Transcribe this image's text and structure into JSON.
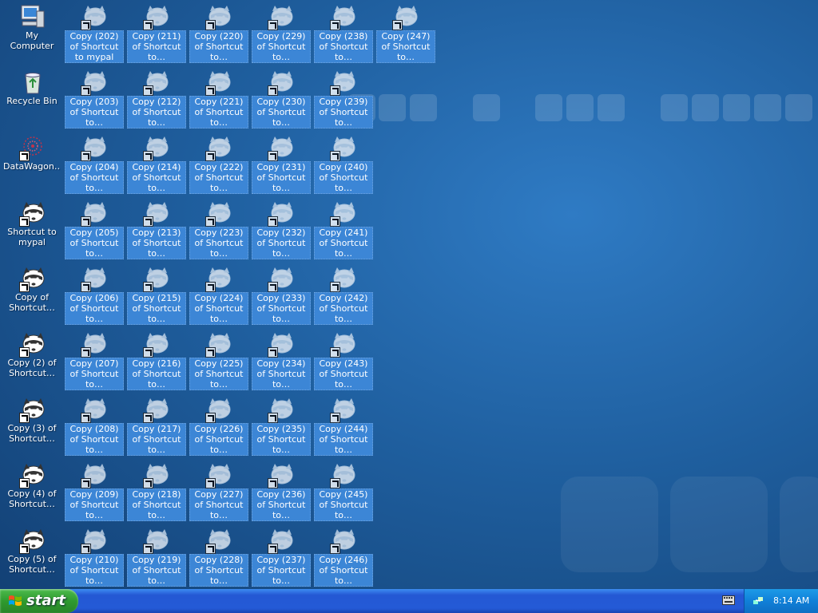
{
  "desktop": {
    "system_icons": [
      {
        "name": "my-computer-icon",
        "label": "My Computer",
        "kind": "computer",
        "selected": false
      },
      {
        "name": "recycle-bin-icon",
        "label": "Recycle Bin",
        "kind": "bin",
        "selected": false
      },
      {
        "name": "datawagon-icon",
        "label": "DataWagon…",
        "kind": "data",
        "selected": false
      },
      {
        "name": "shortcut-to-mypal-icon",
        "label": "Shortcut to mypal",
        "kind": "raccoon",
        "selected": false
      },
      {
        "name": "copy-of-shortcut-icon",
        "label": "Copy of Shortcut…",
        "kind": "raccoon",
        "selected": false
      },
      {
        "name": "copy-2-of-shortcut-icon",
        "label": "Copy (2) of Shortcut…",
        "kind": "raccoon",
        "selected": false
      },
      {
        "name": "copy-3-of-shortcut-icon",
        "label": "Copy (3) of Shortcut…",
        "kind": "raccoon",
        "selected": false
      },
      {
        "name": "copy-4-of-shortcut-icon",
        "label": "Copy (4) of Shortcut…",
        "kind": "raccoon",
        "selected": false
      },
      {
        "name": "copy-5-of-shortcut-icon",
        "label": "Copy (5) of Shortcut…",
        "kind": "raccoon",
        "selected": false
      }
    ],
    "columns": [
      [
        "Copy (202) of Shortcut to mypal",
        "Copy (203) of Shortcut to…",
        "Copy (204) of Shortcut to…",
        "Copy (205) of Shortcut to…",
        "Copy (206) of Shortcut to…",
        "Copy (207) of Shortcut to…",
        "Copy (208) of Shortcut to…",
        "Copy (209) of Shortcut to…",
        "Copy (210) of Shortcut to…"
      ],
      [
        "Copy (211) of Shortcut to…",
        "Copy (212) of Shortcut to…",
        "Copy (214) of Shortcut to…",
        "Copy (213) of Shortcut to…",
        "Copy (215) of Shortcut to…",
        "Copy (216) of Shortcut to…",
        "Copy (217) of Shortcut to…",
        "Copy (218) of Shortcut to…",
        "Copy (219) of Shortcut to…"
      ],
      [
        "Copy (220) of Shortcut to…",
        "Copy (221) of Shortcut to…",
        "Copy (222) of Shortcut to…",
        "Copy (223) of Shortcut to…",
        "Copy (224) of Shortcut to…",
        "Copy (225) of Shortcut to…",
        "Copy (226) of Shortcut to…",
        "Copy (227) of Shortcut to…",
        "Copy (228) of Shortcut to…"
      ],
      [
        "Copy (229) of Shortcut to…",
        "Copy (230) of Shortcut to…",
        "Copy (231) of Shortcut to…",
        "Copy (232) of Shortcut to…",
        "Copy (233) of Shortcut to…",
        "Copy (234) of Shortcut to…",
        "Copy (235) of Shortcut to…",
        "Copy (236) of Shortcut to…",
        "Copy (237) of Shortcut to…"
      ],
      [
        "Copy (238) of Shortcut to…",
        "Copy (239) of Shortcut to…",
        "Copy (240) of Shortcut to…",
        "Copy (241) of Shortcut to…",
        "Copy (242) of Shortcut to…",
        "Copy (243) of Shortcut to…",
        "Copy (244) of Shortcut to…",
        "Copy (245) of Shortcut to…",
        "Copy (246) of Shortcut to…"
      ],
      [
        "Copy (247) of Shortcut to…"
      ]
    ]
  },
  "taskbar": {
    "start_label": "start",
    "clock": "8:14 AM"
  },
  "colors": {
    "selection": "#3c86d6",
    "taskbar_blue": "#245ad6",
    "start_green": "#2f9b2f",
    "tray_blue": "#1080d8"
  }
}
